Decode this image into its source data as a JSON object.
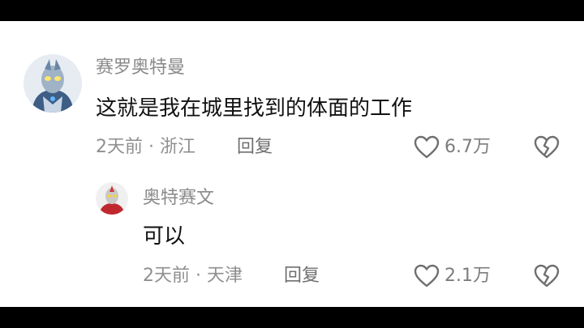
{
  "comments": [
    {
      "user": "赛罗奥特曼",
      "text": "这就是我在城里找到的体面的工作",
      "meta": "2天前 · 浙江",
      "reply_label": "回复",
      "like_count": "6.7万",
      "avatar_icon": "ultraman-zero-avatar"
    }
  ],
  "replies": [
    {
      "user": "奥特赛文",
      "text": "可以",
      "meta": "2天前 · 天津",
      "reply_label": "回复",
      "like_count": "2.1万",
      "avatar_icon": "ultraseven-avatar"
    }
  ],
  "icons": {
    "like": "heart-outline-icon",
    "dislike": "broken-heart-icon"
  },
  "colors": {
    "background": "#ffffff",
    "username": "#8a8a8a",
    "text": "#111111",
    "meta": "#8f8f8f"
  }
}
